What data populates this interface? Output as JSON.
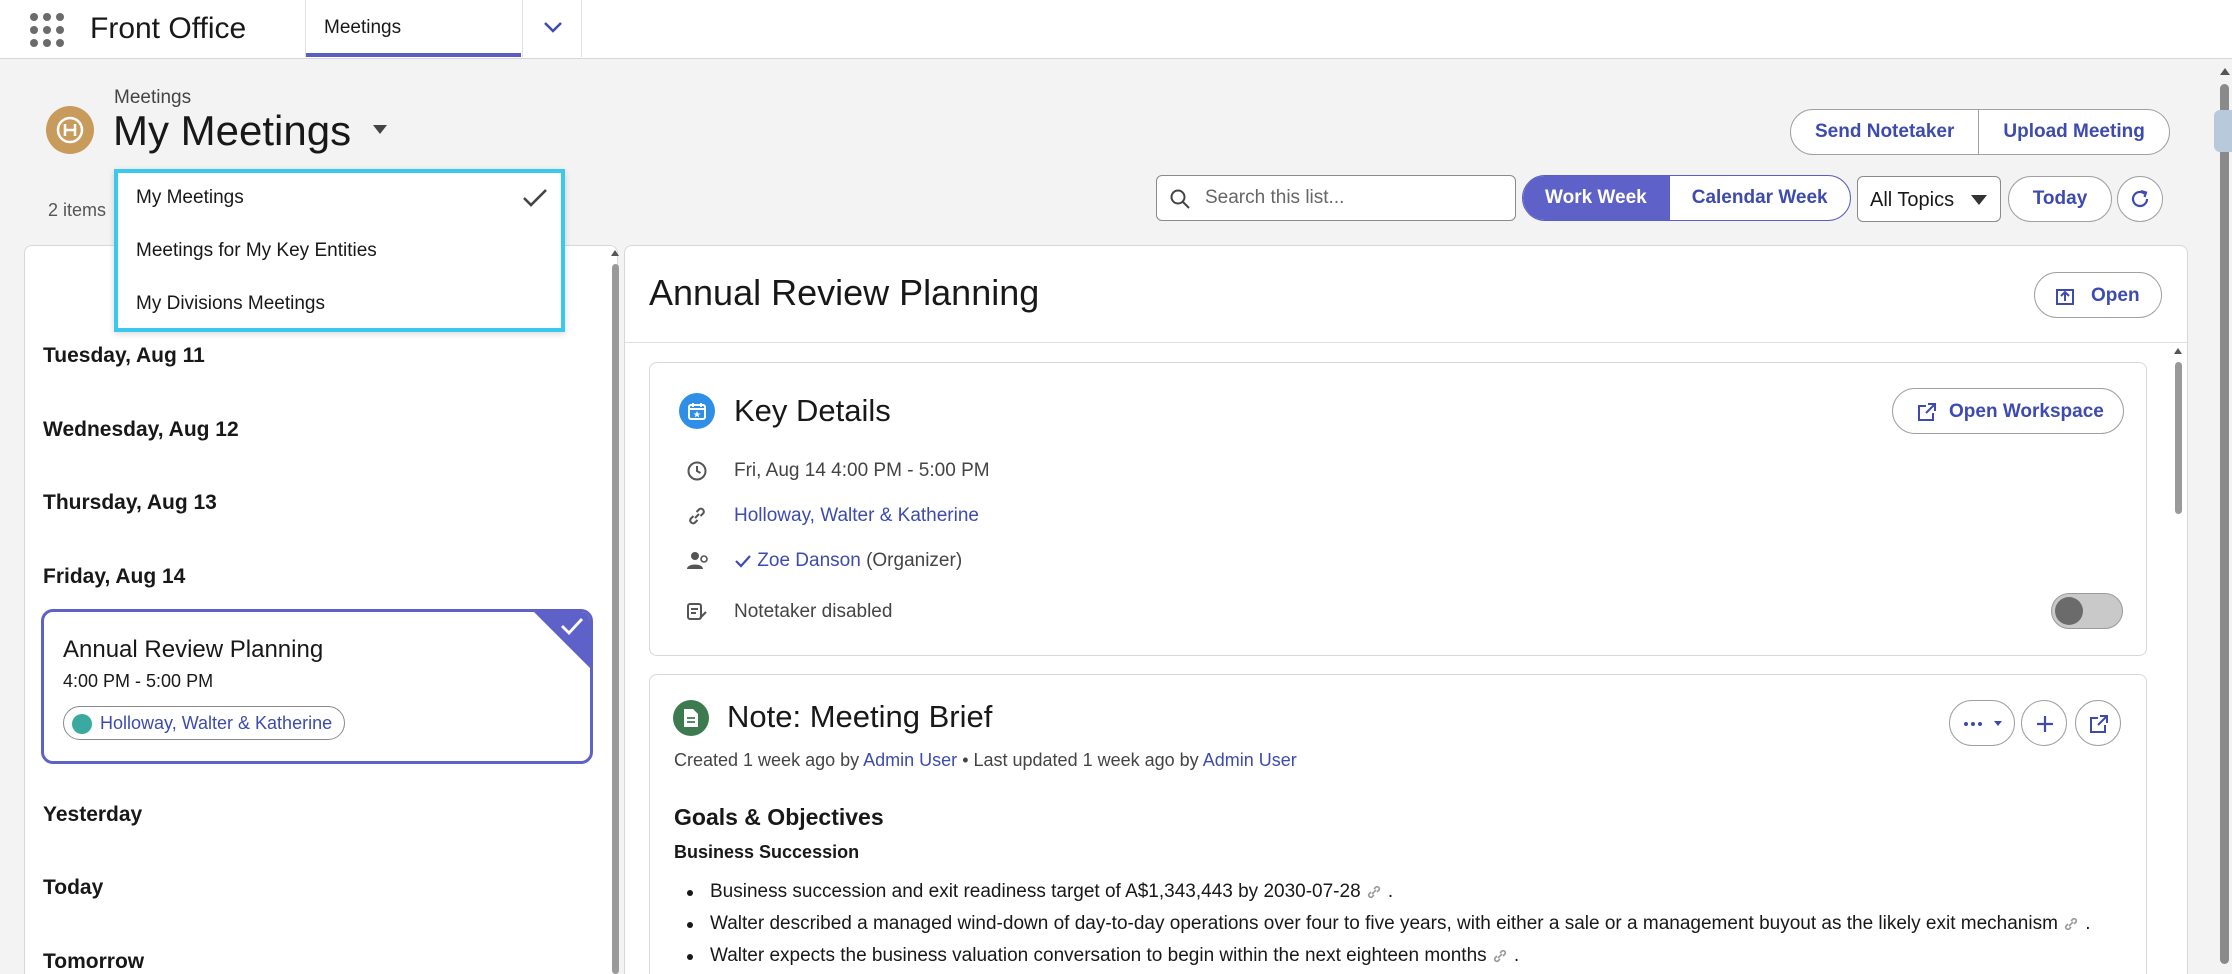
{
  "app": {
    "name": "Front Office"
  },
  "nav": {
    "active_tab": "Meetings"
  },
  "header": {
    "breadcrumb": "Meetings",
    "title": "My Meetings",
    "items_count": "2 items",
    "actions": [
      "Send Notetaker",
      "Upload Meeting"
    ]
  },
  "dropdown": {
    "options": [
      "My Meetings",
      "Meetings for My Key Entities",
      "My Divisions Meetings"
    ],
    "selected": "My Meetings"
  },
  "toolbar": {
    "search_placeholder": "Search this list...",
    "view_options": [
      "Work Week",
      "Calendar Week"
    ],
    "active_view": "Work Week",
    "topics_value": "All Topics",
    "today_label": "Today"
  },
  "agenda": {
    "days": [
      "Tuesday, Aug 11",
      "Wednesday, Aug 12",
      "Thursday, Aug 13",
      "Friday, Aug 14",
      "Yesterday",
      "Today",
      "Tomorrow"
    ],
    "meeting": {
      "title": "Annual Review Planning",
      "time": "4:00 PM - 5:00 PM",
      "entity": "Holloway, Walter & Katherine"
    }
  },
  "detail": {
    "title": "Annual Review Planning",
    "open_label": "Open",
    "key_details": {
      "title": "Key Details",
      "open_workspace_label": "Open Workspace",
      "datetime": "Fri, Aug 14 4:00 PM - 5:00 PM",
      "entity": "Holloway, Walter & Katherine",
      "organizer_name": "Zoe Danson",
      "organizer_role": "(Organizer)",
      "notetaker_status": "Notetaker disabled",
      "notetaker_enabled": false
    },
    "note": {
      "title": "Note: Meeting Brief",
      "meta_created": "Created 1 week ago by",
      "meta_created_by": "Admin User",
      "meta_updated": "• Last updated 1 week ago by",
      "meta_updated_by": "Admin User",
      "section_title": "Goals & Objectives",
      "subsection_title": "Business Succession",
      "bullets": [
        "Business succession and exit readiness target of A$1,343,443 by 2030-07-28",
        "Walter described a managed wind-down of day-to-day operations over four to five years, with either a sale or a management buyout as the likely exit mechanism",
        "Walter expects the business valuation conversation to begin within the next eighteen months"
      ]
    }
  },
  "colors": {
    "accent": "#5e61c8",
    "link": "#3d4bb0",
    "highlight_border": "#3bc8ef"
  }
}
